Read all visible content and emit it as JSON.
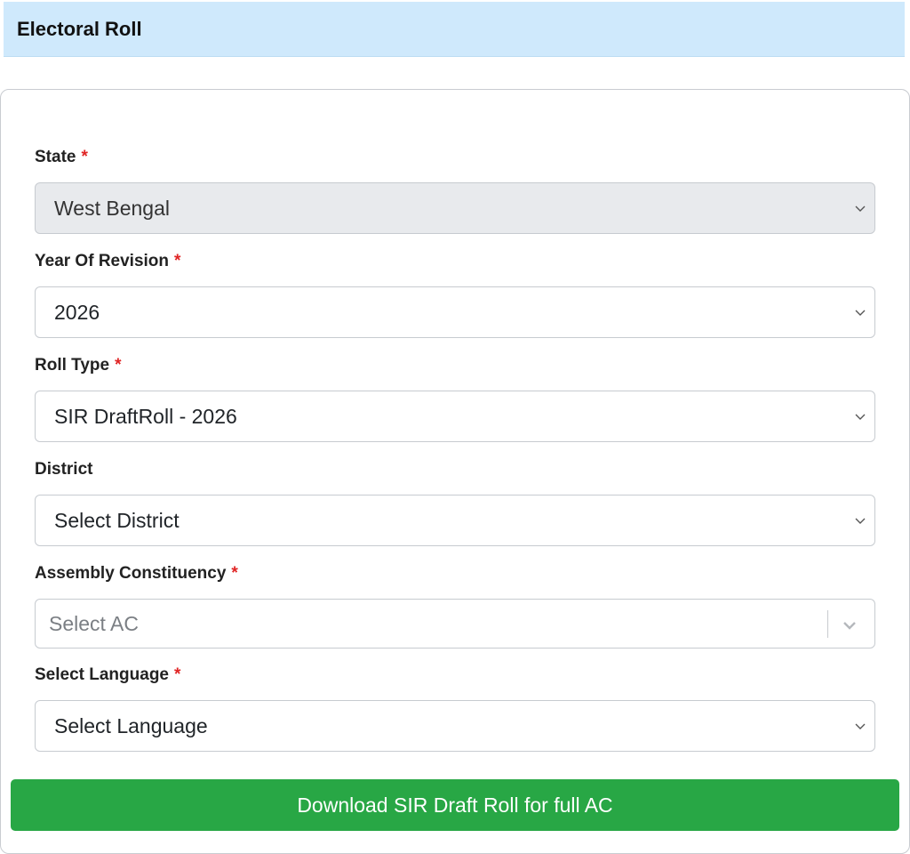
{
  "header": {
    "title": "Electoral Roll"
  },
  "form": {
    "required_mark": "*",
    "state": {
      "label": "State",
      "value": "West Bengal",
      "disabled": true
    },
    "year": {
      "label": "Year Of Revision",
      "value": "2026"
    },
    "roll_type": {
      "label": "Roll Type",
      "value": "SIR DraftRoll - 2026"
    },
    "district": {
      "label": "District",
      "value": "Select District"
    },
    "assembly": {
      "label": "Assembly Constituency",
      "placeholder": "Select AC"
    },
    "language": {
      "label": "Select Language",
      "value": "Select Language"
    }
  },
  "download_button": {
    "label": "Download SIR Draft Roll for full AC",
    "color": "#28a745"
  },
  "colors": {
    "header_bg": "#cfe9fc",
    "required": "#e02424"
  },
  "icons": {
    "select_arrow": "chevron-down-icon"
  }
}
